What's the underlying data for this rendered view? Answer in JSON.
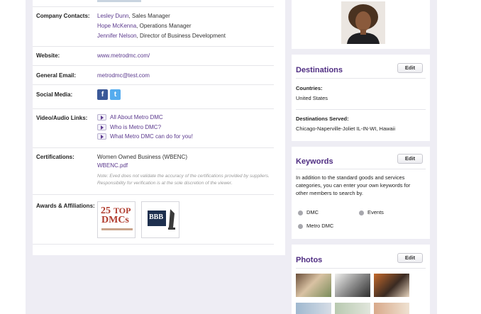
{
  "company_contacts": {
    "label": "Company Contacts:",
    "contacts": [
      {
        "name": "Lesley Dunn",
        "title": ", Sales Manager"
      },
      {
        "name": "Hope McKenna",
        "title": ", Operations Manager"
      },
      {
        "name": "Jennifer Nelson",
        "title": ", Director of Business Development"
      }
    ]
  },
  "website": {
    "label": "Website:",
    "value": "www.metrodmc.com/"
  },
  "general_email": {
    "label": "General Email:",
    "value": "metrodmc@test.com"
  },
  "social_media": {
    "label": "Social Media:",
    "icons": [
      "facebook-icon",
      "twitter-icon"
    ],
    "facebook_glyph": "f",
    "twitter_glyph": "t"
  },
  "video_audio": {
    "label": "Video/Audio Links:",
    "links": [
      "All About Metro DMC",
      "Who is Metro DMC?",
      "What Metro DMC can do for you!"
    ]
  },
  "certifications": {
    "label": "Certifications:",
    "name": "Women Owned Business (WBENC)",
    "file": "WBENC.pdf",
    "note": "Note: Eved does not validate the accuracy of the certifications provided by suppliers. Responsibility for verification is at the sole discretion of the viewer."
  },
  "awards": {
    "label": "Awards & Affiliations:",
    "top25": {
      "number": "25",
      "top": "TOP",
      "dmcs": "DMCs"
    },
    "bbb": {
      "text": "BBB"
    }
  },
  "destinations": {
    "title": "Destinations",
    "edit_label": "Edit",
    "countries_label": "Countries:",
    "countries_value": "United States",
    "served_label": "Destinations Served:",
    "served_value": "Chicago-Naperville-Joliet IL-IN-WI, Hawaii"
  },
  "keywords": {
    "title": "Keywords",
    "edit_label": "Edit",
    "description": [
      "In addition to the standard goods and services",
      "categories, you can enter your own keywords for",
      "other members to search by."
    ],
    "items": [
      "DMC",
      "Events",
      "Metro DMC"
    ]
  },
  "photos": {
    "title": "Photos",
    "edit_label": "Edit"
  },
  "colors": {
    "accent": "#4f2d82",
    "link": "#5c3a8e",
    "background": "#eeedf4"
  }
}
